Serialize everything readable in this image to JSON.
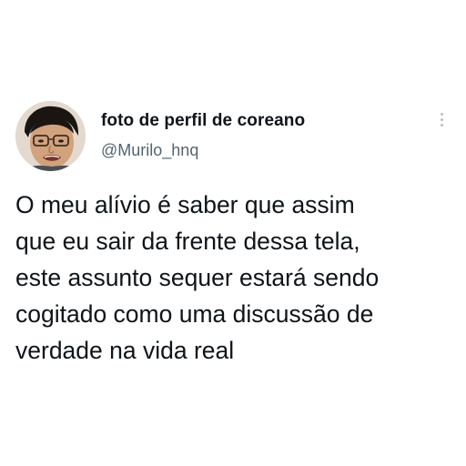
{
  "tweet": {
    "author": {
      "display_name": "foto de perfil de coreano",
      "handle": "@Murilo_hnq",
      "avatar_icon": "profile-photo"
    },
    "menu_icon": "more-vertical-icon",
    "text_lines": [
      "O meu alívio é saber que assim",
      "que eu sair da frente dessa tela,",
      "este assunto sequer estará sendo",
      "cogitado como uma discussão de",
      "verdade na vida real"
    ]
  }
}
